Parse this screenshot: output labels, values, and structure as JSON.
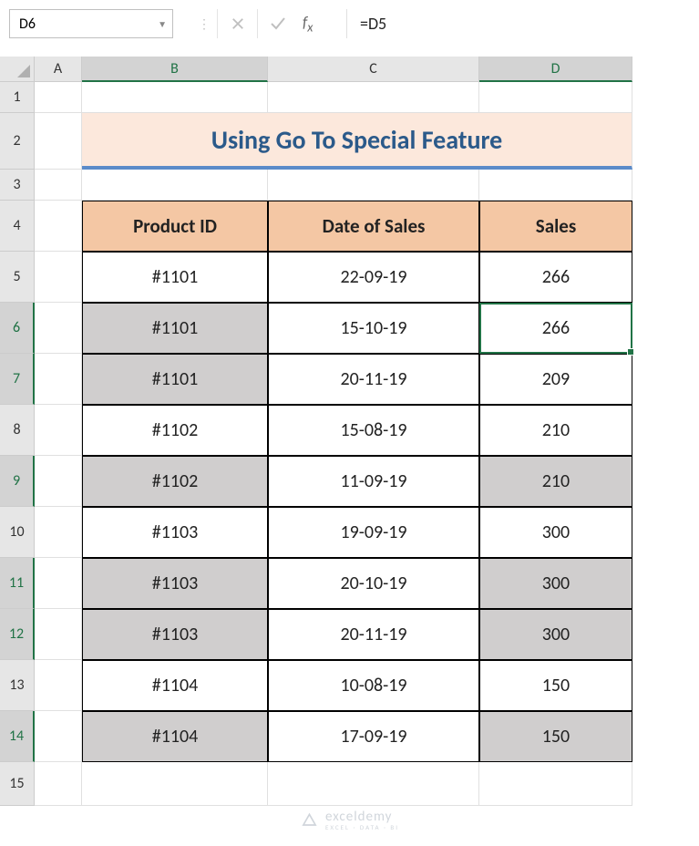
{
  "namebox": "D6",
  "formula": "=D5",
  "columns": {
    "A": "A",
    "B": "B",
    "C": "C",
    "D": "D"
  },
  "rows_labels": [
    "1",
    "2",
    "3",
    "4",
    "5",
    "6",
    "7",
    "8",
    "9",
    "10",
    "11",
    "12",
    "13",
    "14",
    "15"
  ],
  "title": "Using Go To Special Feature",
  "table": {
    "headers": {
      "b": "Product ID",
      "c": "Date of Sales",
      "d": "Sales"
    },
    "rows": [
      {
        "b": "#1101",
        "c": "22-09-19",
        "d": "266",
        "b_grey": false,
        "d_grey": false
      },
      {
        "b": "#1101",
        "c": "15-10-19",
        "d": "266",
        "b_grey": true,
        "d_grey": false
      },
      {
        "b": "#1101",
        "c": "20-11-19",
        "d": "209",
        "b_grey": true,
        "d_grey": false
      },
      {
        "b": "#1102",
        "c": "15-08-19",
        "d": "210",
        "b_grey": false,
        "d_grey": false
      },
      {
        "b": "#1102",
        "c": "11-09-19",
        "d": "210",
        "b_grey": true,
        "d_grey": true
      },
      {
        "b": "#1103",
        "c": "19-09-19",
        "d": "300",
        "b_grey": false,
        "d_grey": false
      },
      {
        "b": "#1103",
        "c": "20-10-19",
        "d": "300",
        "b_grey": true,
        "d_grey": true
      },
      {
        "b": "#1103",
        "c": "20-11-19",
        "d": "300",
        "b_grey": true,
        "d_grey": true
      },
      {
        "b": "#1104",
        "c": "10-08-19",
        "d": "150",
        "b_grey": false,
        "d_grey": false
      },
      {
        "b": "#1104",
        "c": "17-09-19",
        "d": "150",
        "b_grey": true,
        "d_grey": true
      }
    ]
  },
  "active_rows": [
    6,
    7,
    9,
    11,
    12,
    14
  ],
  "active_col": "D",
  "active_cell_row": 6,
  "watermark": {
    "text": "exceldemy",
    "sub": "EXCEL · DATA · BI"
  }
}
